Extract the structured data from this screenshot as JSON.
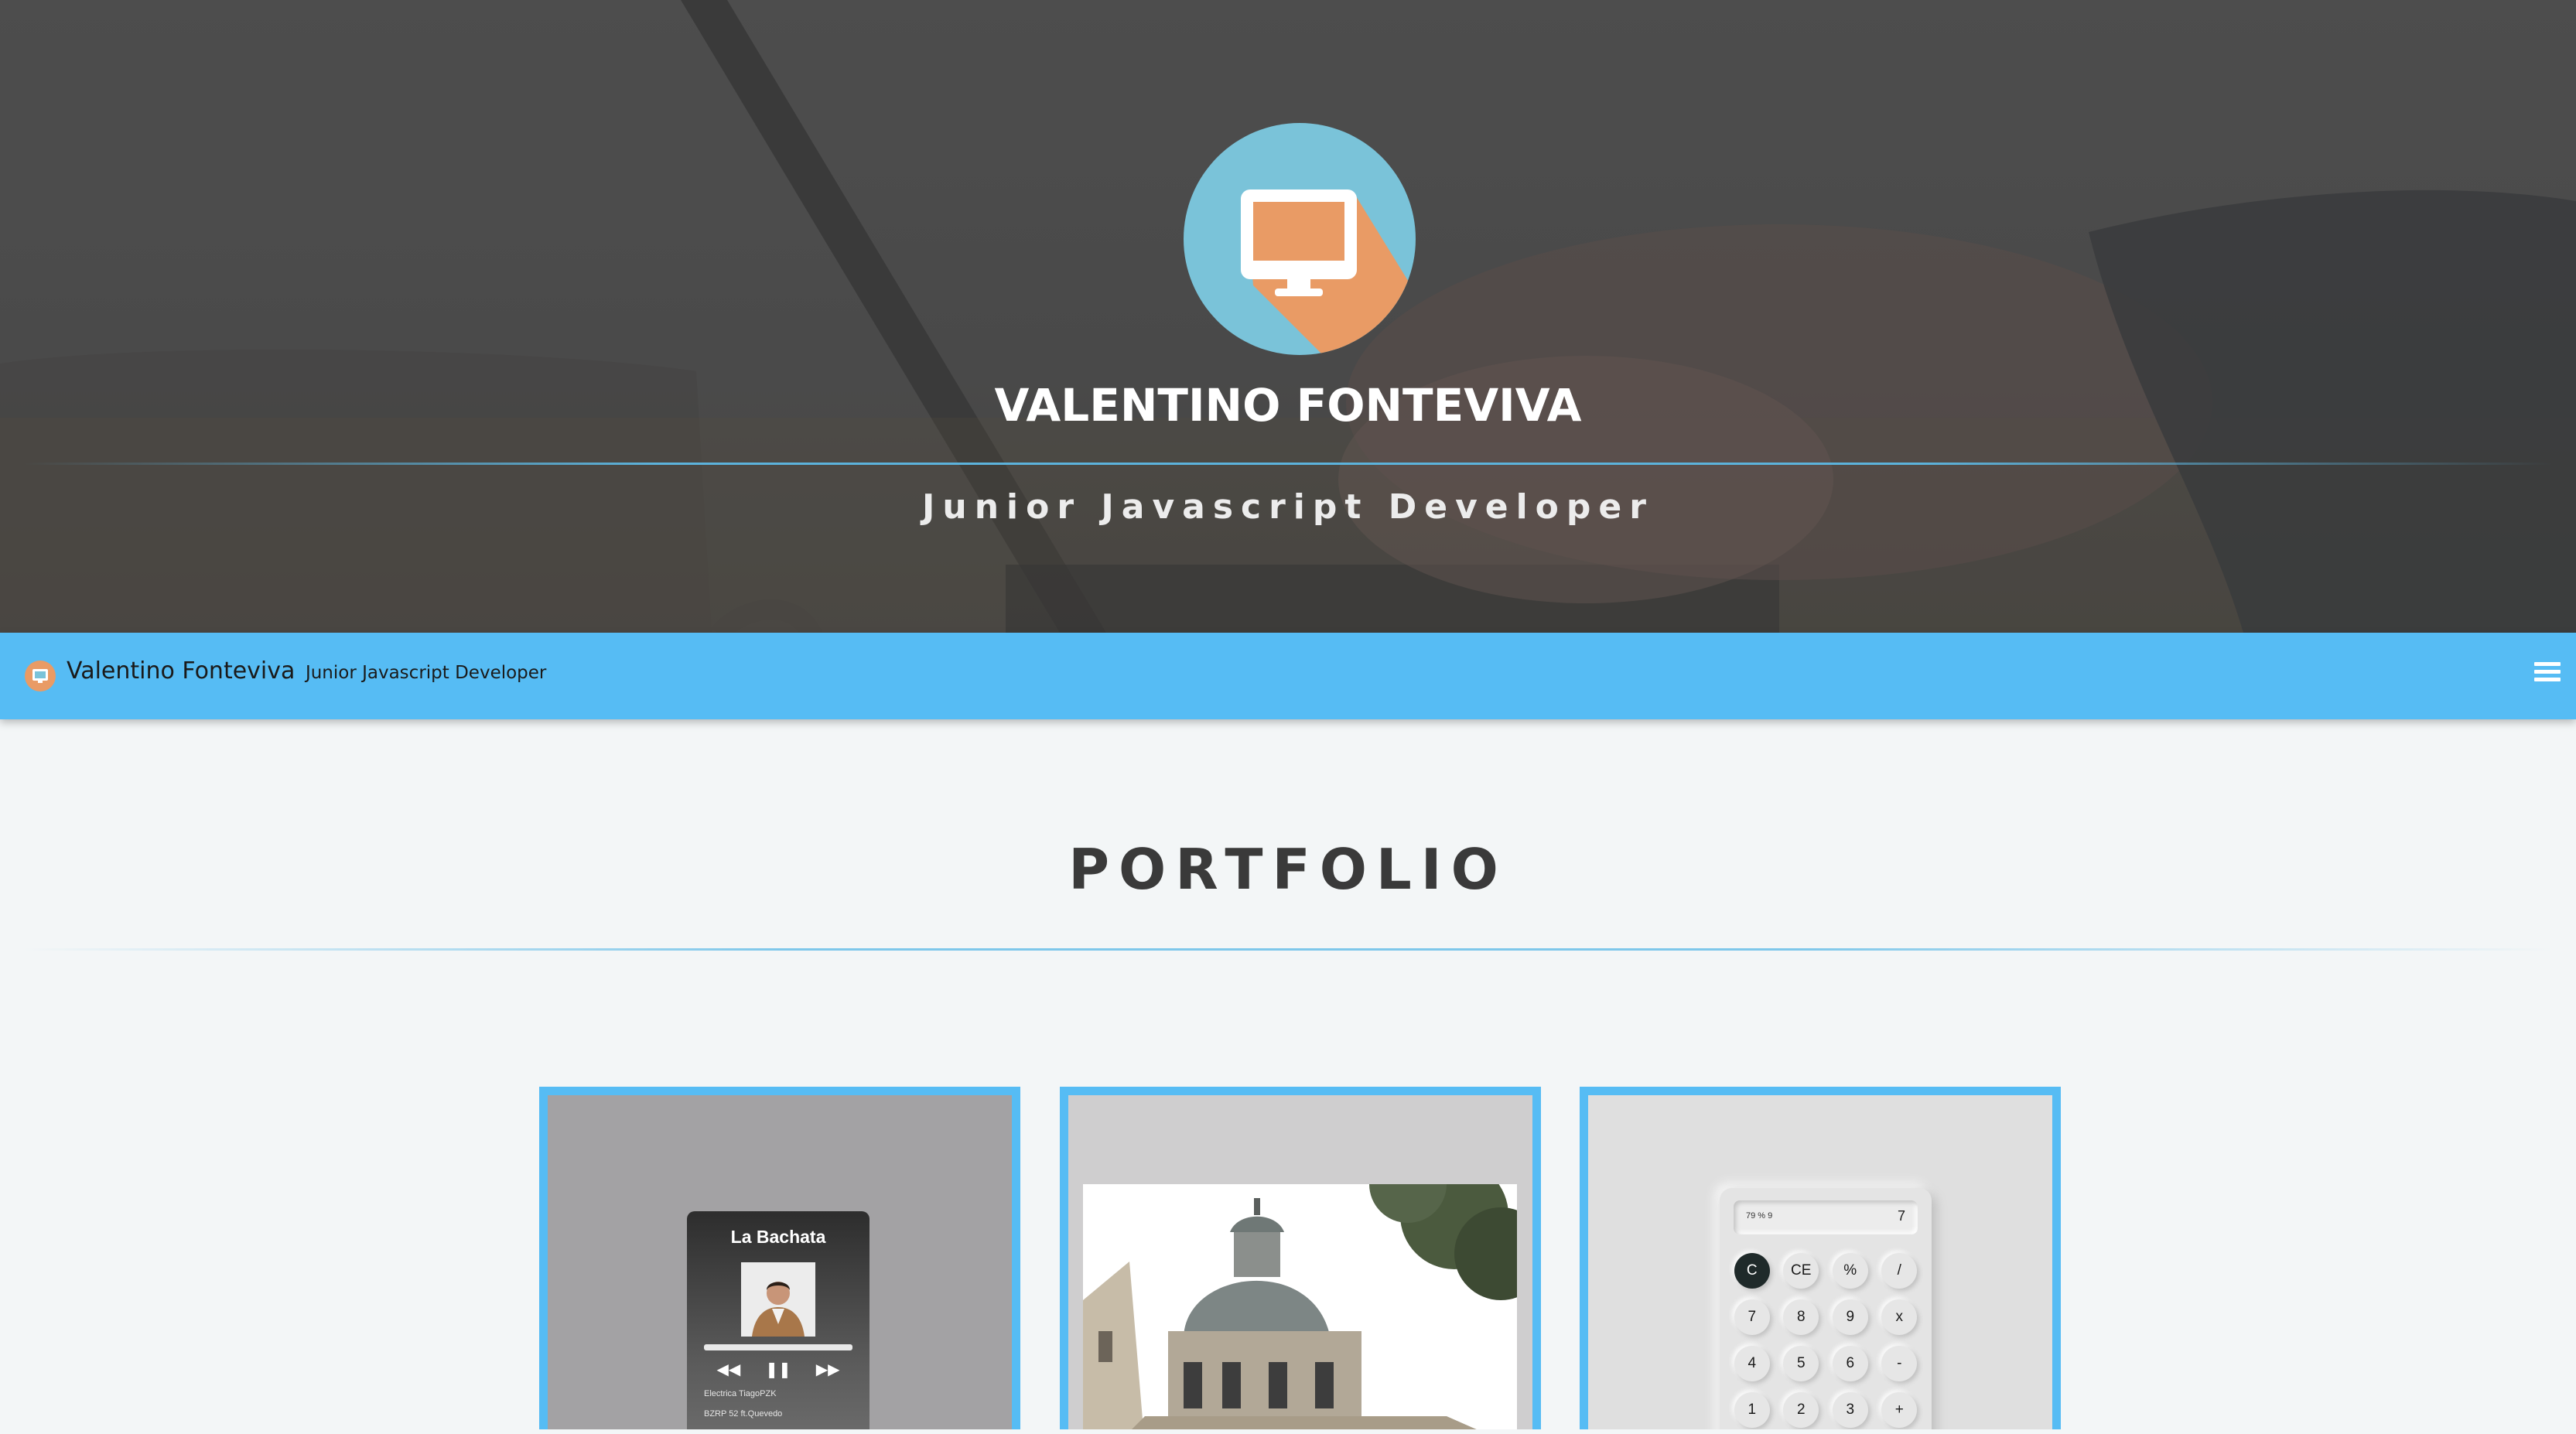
{
  "hero": {
    "name": "VALENTINO FONTEVIVA",
    "subtitle": "Junior Javascript Developer",
    "logo_icon": "monitor-icon"
  },
  "navbar": {
    "brand_name": "Valentino Fonteviva",
    "brand_sub": "Junior Javascript Developer",
    "menu_icon": "hamburger-menu-icon",
    "color": "#56bcf4"
  },
  "portfolio": {
    "title": "PORTFOLIO",
    "cards": [
      {
        "kind": "music-player",
        "player": {
          "title": "La Bachata",
          "tracks": [
            "Electrica TiagoPZK",
            "BZRP 52 ft.Quevedo"
          ]
        }
      },
      {
        "kind": "building-photo"
      },
      {
        "kind": "calculator",
        "calculator": {
          "expression": "79 % 9",
          "result": "7",
          "keys": [
            "C",
            "CE",
            "%",
            "/",
            "7",
            "8",
            "9",
            "x",
            "4",
            "5",
            "6",
            "-",
            "1",
            "2",
            "3",
            "+"
          ]
        }
      }
    ]
  },
  "colors": {
    "accent": "#56bcf4",
    "logo_bg": "#7ac3d9",
    "logo_orange": "#e99b65"
  }
}
